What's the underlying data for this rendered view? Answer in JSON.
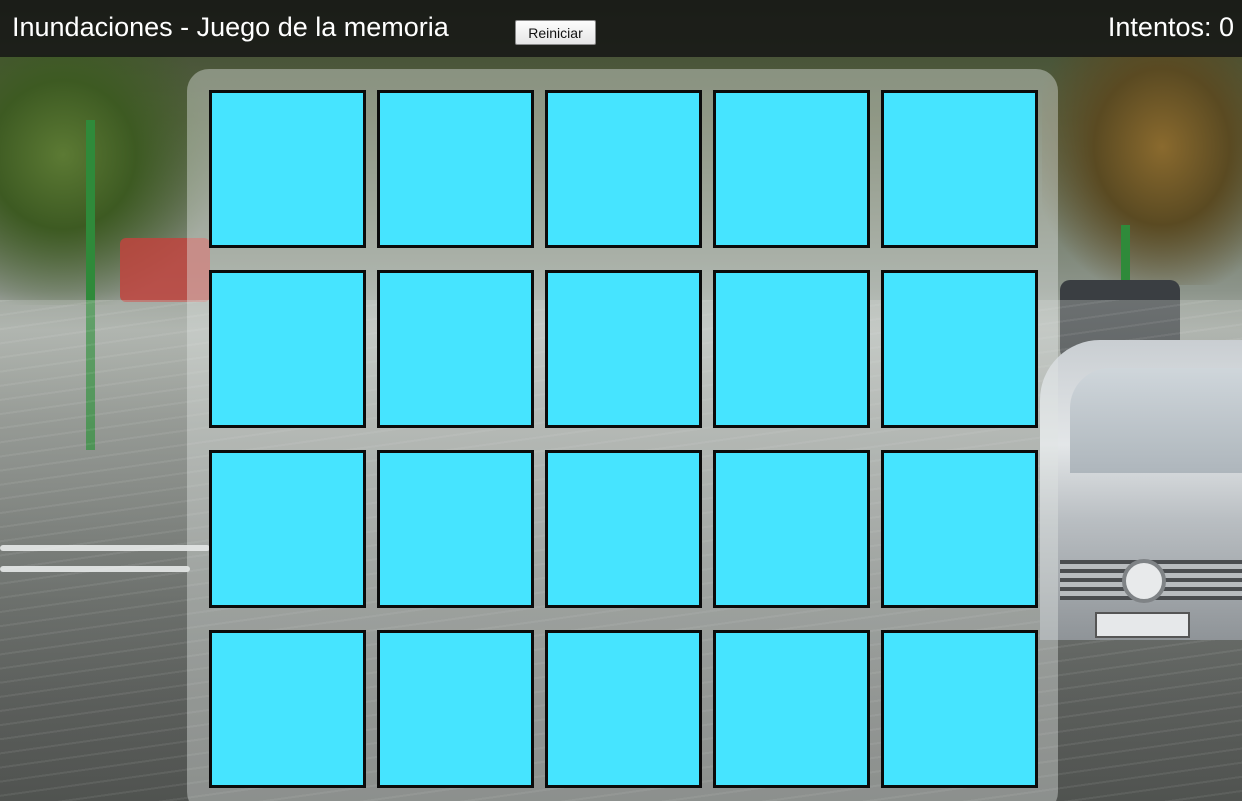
{
  "header": {
    "title": "Inundaciones - Juego de la memoria",
    "reset_label": "Reiniciar",
    "attempts_text": "Intentos: 0"
  },
  "board": {
    "rows": 4,
    "columns": 5,
    "card_back_color": "#46e4ff",
    "cards_face_down": 20
  },
  "colors": {
    "header_bg": "#141414",
    "card_border": "#0b0b0b"
  }
}
